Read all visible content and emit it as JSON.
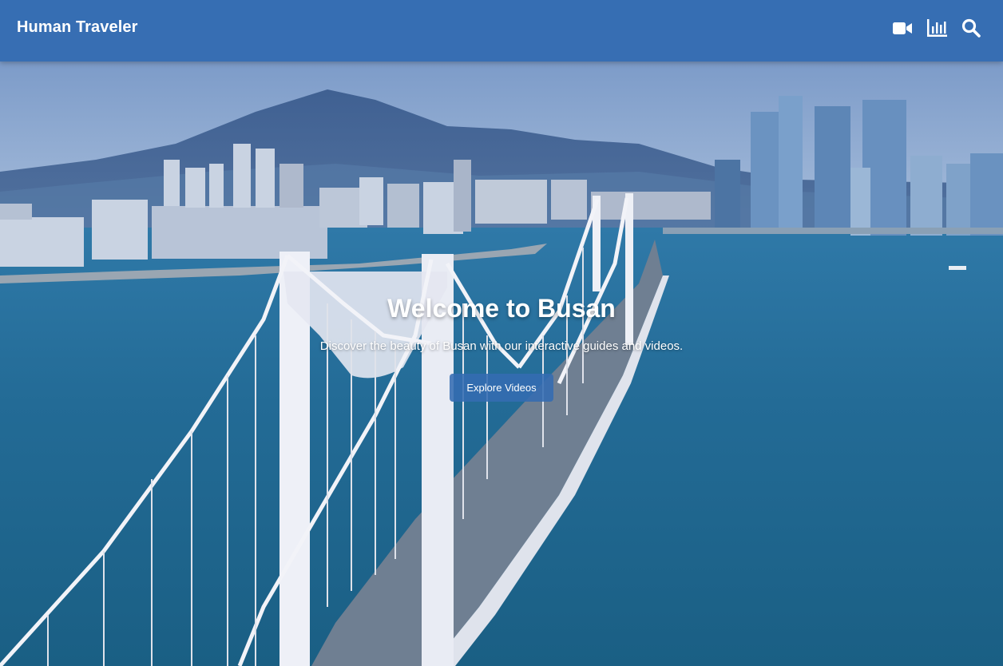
{
  "navbar": {
    "brand": "Human Traveler",
    "icons": [
      {
        "name": "video-icon",
        "color": "#ffffff"
      },
      {
        "name": "bar-chart-icon",
        "color": "#ffffff"
      },
      {
        "name": "search-icon",
        "color": "#ffffff"
      }
    ]
  },
  "hero": {
    "title": "Welcome to Busan",
    "subtitle": "Discover the beauty of Busan with our interactive guides and videos.",
    "button_label": "Explore Videos",
    "background_image": "aerial view of a white suspension bridge over blue sea with city skyline and mountain"
  },
  "colors": {
    "nav_background": "#346cb2",
    "button_background": "#346cb2",
    "text": "#ffffff"
  }
}
